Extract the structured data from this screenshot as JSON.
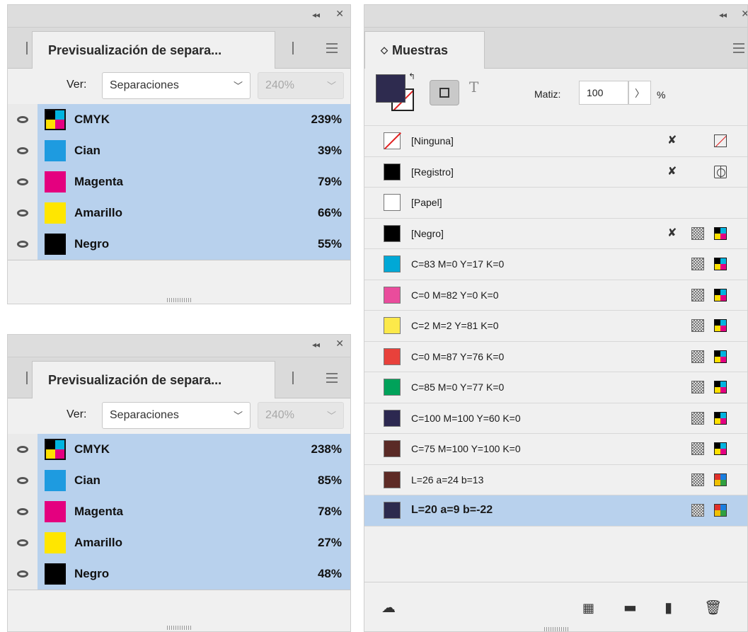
{
  "separations_panels": [
    {
      "title": "Previsualización de separa...",
      "view_label": "Ver:",
      "view_value": "Separaciones",
      "coverage_value": "240%",
      "inks": [
        {
          "name": "CMYK",
          "pct": "239%",
          "swatch": "cmyk"
        },
        {
          "name": "Cian",
          "pct": "39%",
          "swatch": "#1e9be0"
        },
        {
          "name": "Magenta",
          "pct": "79%",
          "swatch": "#e4007f"
        },
        {
          "name": "Amarillo",
          "pct": "66%",
          "swatch": "#ffe600"
        },
        {
          "name": "Negro",
          "pct": "55%",
          "swatch": "#000000"
        }
      ]
    },
    {
      "title": "Previsualización de separa...",
      "view_label": "Ver:",
      "view_value": "Separaciones",
      "coverage_value": "240%",
      "inks": [
        {
          "name": "CMYK",
          "pct": "238%",
          "swatch": "cmyk"
        },
        {
          "name": "Cian",
          "pct": "85%",
          "swatch": "#1e9be0"
        },
        {
          "name": "Magenta",
          "pct": "78%",
          "swatch": "#e4007f"
        },
        {
          "name": "Amarillo",
          "pct": "27%",
          "swatch": "#ffe600"
        },
        {
          "name": "Negro",
          "pct": "48%",
          "swatch": "#000000"
        }
      ]
    }
  ],
  "swatches_panel": {
    "title": "Muestras",
    "tint_label": "Matiz:",
    "tint_value": "100",
    "tint_unit": "%",
    "fill_color": "#2e2b4f",
    "swatches": [
      {
        "label": "[Ninguna]",
        "color": "none",
        "icons": [
          "pencil-x",
          "none-frame"
        ]
      },
      {
        "label": "[Registro]",
        "color": "#000000",
        "icons": [
          "pencil-x",
          "registration"
        ]
      },
      {
        "label": "[Papel]",
        "color": "#ffffff",
        "icons": []
      },
      {
        "label": "[Negro]",
        "color": "#000000",
        "icons": [
          "pencil-x",
          "process",
          "cmyk"
        ]
      },
      {
        "label": "C=83 M=0 Y=17 K=0",
        "color": "#00a8d6",
        "icons": [
          "process",
          "cmyk"
        ]
      },
      {
        "label": "C=0 M=82 Y=0 K=0",
        "color": "#ea4c9c",
        "icons": [
          "process",
          "cmyk"
        ]
      },
      {
        "label": "C=2 M=2 Y=81 K=0",
        "color": "#fce94a",
        "icons": [
          "process",
          "cmyk"
        ]
      },
      {
        "label": "C=0 M=87 Y=76 K=0",
        "color": "#e8413b",
        "icons": [
          "process",
          "cmyk"
        ]
      },
      {
        "label": "C=85 M=0 Y=77 K=0",
        "color": "#00a25a",
        "icons": [
          "process",
          "cmyk"
        ]
      },
      {
        "label": "C=100 M=100 Y=60 K=0",
        "color": "#2c2850",
        "icons": [
          "process",
          "cmyk"
        ]
      },
      {
        "label": "C=75 M=100 Y=100 K=0",
        "color": "#5a2a26",
        "icons": [
          "process",
          "cmyk"
        ]
      },
      {
        "label": "L=26 a=24 b=13",
        "color": "#5e2b26",
        "icons": [
          "process",
          "lab"
        ]
      },
      {
        "label": "L=20 a=9 b=-22",
        "color": "#2c2a4e",
        "icons": [
          "process",
          "lab"
        ],
        "selected": true
      }
    ]
  }
}
